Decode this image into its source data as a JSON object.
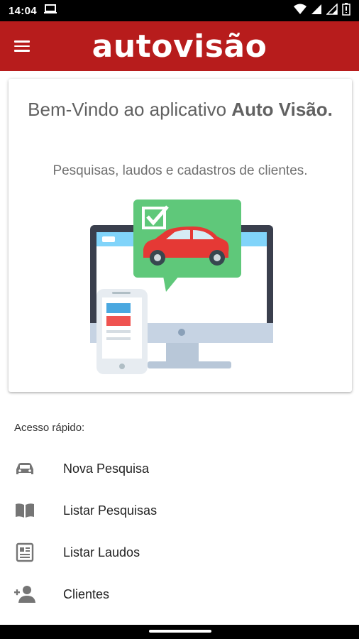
{
  "status_bar": {
    "time": "14:04"
  },
  "app_bar": {
    "logo_text": "autovisão",
    "brand_color": "#b71c1c"
  },
  "welcome_card": {
    "title_prefix": "Bem-Vindo ao aplicativo ",
    "title_bold": "Auto Visão.",
    "subtitle": "Pesquisas, laudos e cadastros de clientes."
  },
  "quick_access": {
    "label": "Acesso rápido:",
    "items": [
      {
        "label": "Nova Pesquisa",
        "icon": "car-icon"
      },
      {
        "label": "Listar Pesquisas",
        "icon": "book-icon"
      },
      {
        "label": "Listar Laudos",
        "icon": "document-icon"
      },
      {
        "label": "Clientes",
        "icon": "add-person-icon"
      }
    ]
  }
}
